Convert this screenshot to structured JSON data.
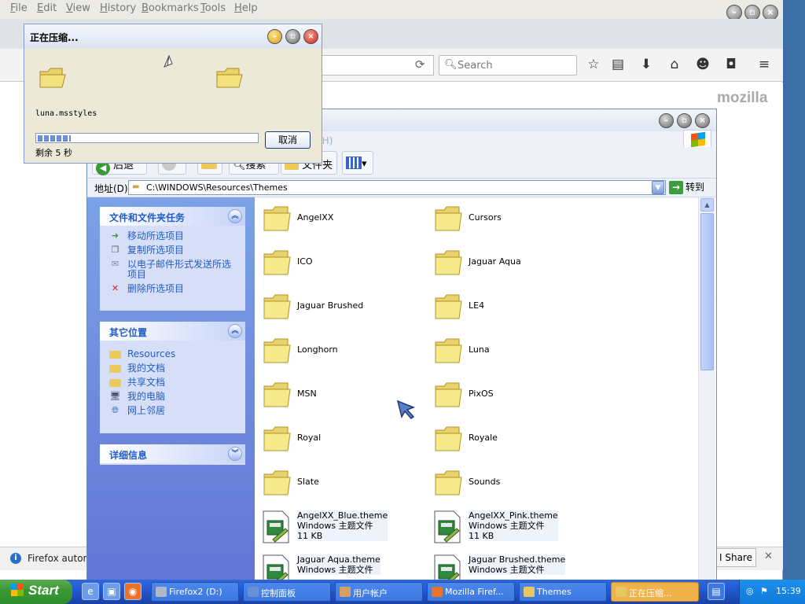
{
  "firefox": {
    "menus": [
      {
        "label": "File",
        "ul": "F",
        "rest": "ile"
      },
      {
        "label": "Edit",
        "ul": "E",
        "rest": "dit"
      },
      {
        "label": "View",
        "ul": "V",
        "rest": "iew"
      },
      {
        "label": "History",
        "ul": "H",
        "rest": "istory"
      },
      {
        "label": "Bookmarks",
        "ul": "B",
        "rest": "ookmarks"
      },
      {
        "label": "Tools",
        "ul": "T",
        "rest": "ools"
      },
      {
        "label": "Help",
        "ul": "H",
        "rest": "elp"
      }
    ],
    "search_placeholder": "Search",
    "brand": "mozilla",
    "notification_text": "Firefox autom",
    "share_label": "I Share",
    "close_glyph": "✕"
  },
  "explorer": {
    "menu_help": "助(H)",
    "toolbar": {
      "back": "后退",
      "search": "搜索",
      "folders": "文件夹"
    },
    "address_label": "地址(D)",
    "address_value": "C:\\WINDOWS\\Resources\\Themes",
    "go_label": "转到",
    "tasks_panel": {
      "title": "文件和文件夹任务",
      "items": [
        "移动所选项目",
        "复制所选项目",
        "以电子邮件形式发送所选项目",
        "删除所选项目"
      ]
    },
    "places_panel": {
      "title": "其它位置",
      "items": [
        "Resources",
        "我的文档",
        "共享文档",
        "我的电脑",
        "网上邻居"
      ]
    },
    "details_panel": {
      "title": "详细信息"
    },
    "folders": [
      "AngelXX",
      "Cursors",
      "ICO",
      "Jaguar Aqua",
      "Jaguar Brushed",
      "LE4",
      "Longhorn",
      "Luna",
      "MSN",
      "PixOS",
      "Royal",
      "Royale",
      "Slate",
      "Sounds"
    ],
    "theme_files": [
      {
        "name": "AngelXX_Blue.theme",
        "type": "Windows 主题文件",
        "size": "11 KB"
      },
      {
        "name": "AngelXX_Pink.theme",
        "type": "Windows 主题文件",
        "size": "11 KB"
      },
      {
        "name": "Jaguar Aqua.theme",
        "type": "Windows 主题文件",
        "size": ""
      },
      {
        "name": "Jaguar Brushed.theme",
        "type": "Windows 主题文件",
        "size": ""
      }
    ]
  },
  "dialog": {
    "title": "正在压缩...",
    "file": "luna.msstyles",
    "remaining": "剩余 5 秒",
    "cancel": "取消",
    "progress": 0.15
  },
  "taskbar": {
    "start": "Start",
    "tasks": [
      {
        "label": "Firefox2 (D:)",
        "color": "#b0b8c8"
      },
      {
        "label": "控制面板",
        "color": "#6b8fd8"
      },
      {
        "label": "用户帐户",
        "color": "#d8a060"
      },
      {
        "label": "Mozilla Firef...",
        "color": "#e8742a"
      },
      {
        "label": "Themes",
        "color": "#e8c860"
      },
      {
        "label": "正在压缩...",
        "color": "#e8c860",
        "active": true
      }
    ],
    "clock": "15:39"
  }
}
